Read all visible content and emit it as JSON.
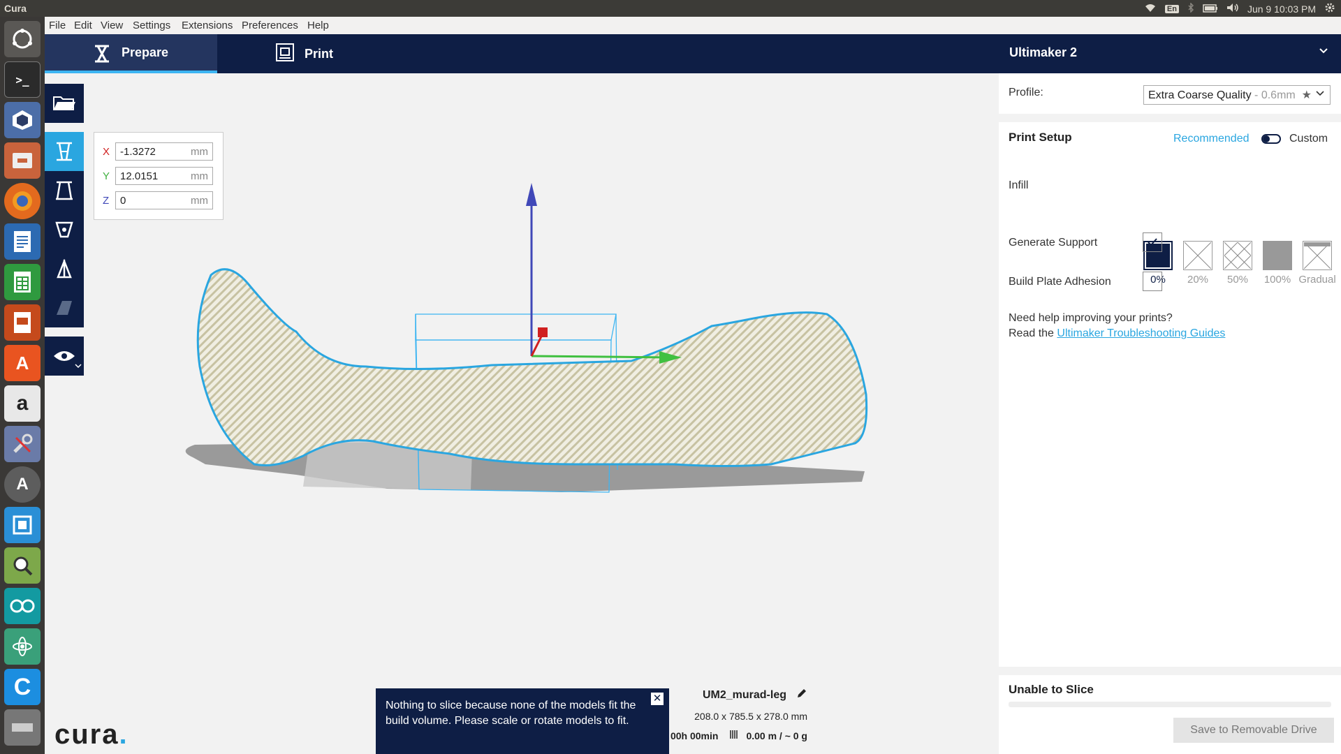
{
  "topbar": {
    "app_name": "Cura",
    "keyboard": "En",
    "datetime": "Jun 9 10:03 PM"
  },
  "menu": [
    "File",
    "Edit",
    "View",
    "Settings",
    "Extensions",
    "Preferences",
    "Help"
  ],
  "tabs": {
    "prepare": "Prepare",
    "print": "Print"
  },
  "printer": {
    "name": "Ultimaker 2"
  },
  "move_panel": {
    "x": {
      "label": "X",
      "value": "-1.3272",
      "unit": "mm"
    },
    "y": {
      "label": "Y",
      "value": "12.0151",
      "unit": "mm"
    },
    "z": {
      "label": "Z",
      "value": "0",
      "unit": "mm"
    }
  },
  "sidebar": {
    "profile_label": "Profile:",
    "profile_name": "Extra Coarse Quality",
    "profile_suffix": " - 0.6mm",
    "print_setup": "Print Setup",
    "mode_recommended": "Recommended",
    "mode_custom": "Custom",
    "infill_label": "Infill",
    "infill_options": [
      "0%",
      "20%",
      "50%",
      "100%",
      "Gradual"
    ],
    "infill_selected": "0%",
    "support_label": "Generate Support",
    "support_checked": true,
    "adhesion_label": "Build Plate Adhesion",
    "adhesion_checked": false,
    "help_line1": "Need help improving your prints?",
    "help_line2": "Read the ",
    "help_link": "Ultimaker Troubleshooting Guides",
    "slice_status": "Unable to Slice",
    "save_button": "Save to Removable Drive"
  },
  "job": {
    "name": "UM2_murad-leg",
    "dimensions": "208.0 x 785.5 x 278.0 mm",
    "time": "00h 00min",
    "material": "0.00 m / ~ 0 g"
  },
  "toast": {
    "message": "Nothing to slice because none of the models fit the build volume. Please scale or rotate models to fit."
  },
  "logo": {
    "text": "cura",
    "dot": "."
  },
  "colors": {
    "header": "#0e1e45",
    "accent": "#3db5f2",
    "model_outline": "#2aa6e0"
  }
}
